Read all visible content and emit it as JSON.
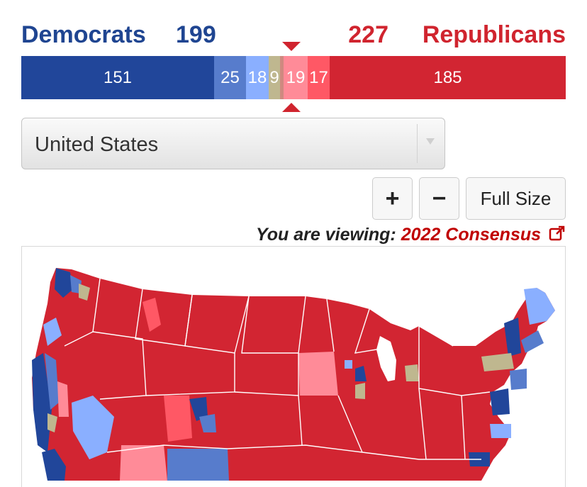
{
  "header": {
    "dem_label": "Democrats",
    "dem_total": "199",
    "rep_total": "227",
    "rep_label": "Republicans"
  },
  "bar": {
    "segments": [
      {
        "name": "safe-dem",
        "label": "151",
        "value": 151,
        "color": "#21469a"
      },
      {
        "name": "likely-dem",
        "label": "25",
        "value": 25,
        "color": "#577ccc"
      },
      {
        "name": "lean-dem",
        "label": "18",
        "value": 18,
        "color": "#8aafff"
      },
      {
        "name": "tossup",
        "label": "9",
        "value": 9,
        "color": "#bfb78f"
      },
      {
        "name": "tilt",
        "label": "",
        "value": 3,
        "color": "#cf8980"
      },
      {
        "name": "lean-rep",
        "label": "19",
        "value": 19,
        "color": "#ff8b98"
      },
      {
        "name": "likely-rep",
        "label": "17",
        "value": 17,
        "color": "#ff5865"
      },
      {
        "name": "safe-rep",
        "label": "185",
        "value": 185,
        "color": "#d22532"
      }
    ]
  },
  "select": {
    "value": "United States"
  },
  "controls": {
    "zoom_in": "+",
    "zoom_out": "−",
    "full_size": "Full Size"
  },
  "viewing": {
    "label": "You are viewing:",
    "link": "2022 Consensus"
  },
  "colors": {
    "dem": "#1f4591",
    "rep": "#d0242e",
    "link": "#c00000"
  }
}
